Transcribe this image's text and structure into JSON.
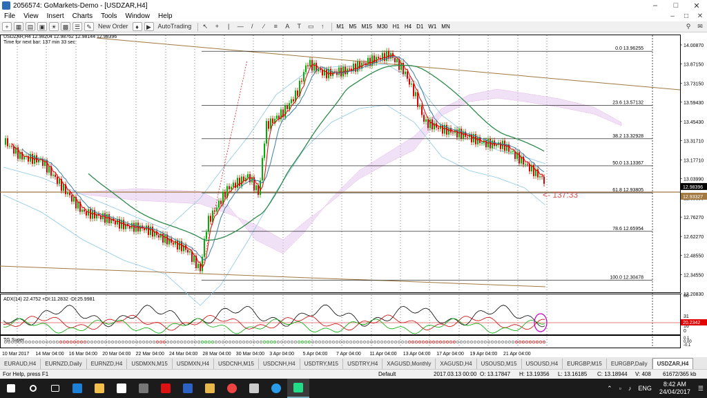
{
  "window": {
    "title": "2056574: GoMarkets-Demo - [USDZAR,H4]"
  },
  "menu": [
    "File",
    "View",
    "Insert",
    "Charts",
    "Tools",
    "Window",
    "Help"
  ],
  "toolbar": {
    "new_order": "New Order",
    "autotrading": "AutoTrading",
    "timeframes": [
      "M1",
      "M5",
      "M15",
      "M30",
      "H1",
      "H4",
      "D1",
      "W1",
      "MN"
    ]
  },
  "chart": {
    "info_line": "USDZAR,H4  12.98204 12.98762 12.98144 12.98396",
    "timer": "Time for next bar: 137 min 33 sec",
    "countdown_label": "<- 137:33",
    "price_axis": [
      "14.00870",
      "13.87150",
      "13.73150",
      "13.59430",
      "13.45430",
      "13.31710",
      "13.17710",
      "13.03990",
      "12.89990",
      "12.76270",
      "12.62270",
      "12.48550",
      "12.34550",
      "12.20830"
    ],
    "current_price": "12.98396",
    "fib_price_tag": "12.93327",
    "fib_levels": [
      {
        "label": "0.0 13.96255",
        "price": 13.96255
      },
      {
        "label": "23.6 13.57132",
        "price": 13.57132
      },
      {
        "label": "38.2 13.32928",
        "price": 13.32928
      },
      {
        "label": "50.0 13.13367",
        "price": 13.13367
      },
      {
        "label": "61.8 12.93805",
        "price": 12.93805
      },
      {
        "label": "78.6 12.65954",
        "price": 12.65954
      },
      {
        "label": "100.0 12.30478",
        "price": 12.30478
      }
    ],
    "date_axis": [
      "10 Mar 2017",
      "14 Mar 04:00",
      "16 Mar 04:00",
      "20 Mar 04:00",
      "22 Mar 04:00",
      "24 Mar 04:00",
      "28 Mar 04:00",
      "30 Mar 04:00",
      "3 Apr 04:00",
      "5 Apr 04:00",
      "7 Apr 04:00",
      "11 Apr 04:00",
      "13 Apr 04:00",
      "17 Apr 04:00",
      "19 Apr 04:00",
      "21 Apr 04:00"
    ],
    "adx": {
      "label": "ADX(14) 22.4752 +DI:11.2832 -DI:25.9981",
      "axis": [
        "60",
        "31",
        "16",
        "0"
      ],
      "value_tag": "20.2342"
    },
    "tg": {
      "label": "TG Super",
      "axis": [
        "0.1",
        "0.00",
        "-0.1"
      ]
    }
  },
  "tabs": [
    "EURAUD,H4",
    "EURNZD,Daily",
    "EURNZD,H4",
    "USDMXN,M15",
    "USDMXN,H4",
    "USDCNH,M15",
    "USDCNH,H4",
    "USDTRY,M15",
    "USDTRY,H4",
    "XAGUSD,Monthly",
    "XAGUSD,H4",
    "USOUSD,M15",
    "USOUSD,H4",
    "EURGBP,M15",
    "EURGBP,Daily",
    "USDZAR,H4"
  ],
  "active_tab": "USDZAR,H4",
  "status": {
    "help": "For Help, press F1",
    "profile": "Default",
    "datetime": "2017.03.13 00:00",
    "open": "O: 13.17847",
    "high": "H: 13.19356",
    "low": "L: 13.16185",
    "close": "C: 13.18944",
    "volume": "V: 408",
    "traffic": "61672/365 kb"
  },
  "taskbar": {
    "lang": "ENG",
    "time": "8:42 AM",
    "date": "24/04/2017"
  },
  "colors": {
    "bull": "#00b000",
    "bear": "#e00000",
    "ichimoku_cloud": "#cc66cc",
    "fib": "#000000",
    "trend": "#a07840"
  }
}
